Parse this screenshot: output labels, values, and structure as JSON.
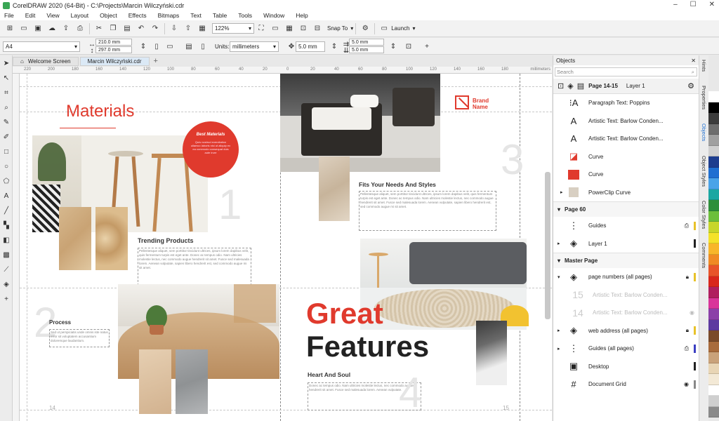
{
  "window": {
    "title": "CorelDRAW 2020 (64-Bit) - C:\\Projects\\Marcin Wilczyński.cdr",
    "min": "–",
    "max": "☐",
    "close": "✕"
  },
  "menu": [
    "File",
    "Edit",
    "View",
    "Layout",
    "Object",
    "Effects",
    "Bitmaps",
    "Text",
    "Table",
    "Tools",
    "Window",
    "Help"
  ],
  "toolbar": {
    "zoom": "122%",
    "snap_to": "Snap To",
    "launch": "Launch"
  },
  "propbar": {
    "page_size": "A4",
    "width": "210.0 mm",
    "height": "297.0 mm",
    "units_label": "Units:",
    "units": "millimeters",
    "nudge": "5.0 mm",
    "dup_x": "5.0 mm",
    "dup_y": "5.0 mm"
  },
  "tabs": [
    "Welcome Screen",
    "Marcin Wilczyński.cdr"
  ],
  "ruler": {
    "ticks": [
      "220",
      "200",
      "180",
      "160",
      "140",
      "120",
      "100",
      "80",
      "60",
      "40",
      "20",
      "0",
      "20",
      "40",
      "60",
      "80",
      "100",
      "120",
      "140",
      "160",
      "180"
    ],
    "unit": "millimeters"
  },
  "canvas": {
    "materials_title": "Materials",
    "best_materials_title": "Best Materials",
    "best_materials_text": "Quis nostrud exercitation ullamco laboris nisi ut aliquip ex ea commodo consequat duis aute irure",
    "trending_title": "Trending Products",
    "trending_text": "Pellentesque aliquet, sem porttitor tincidunt ultrices, ipsum lorem dapibus velit, quis fermentum turpis est eget ante. Donec ac tempus odio. Nam ultricies molestie lectus, nec commodo augue hendrerit sit amet. Fusce sed malesuada lorem. Aenean vulputate, sapien libero hendrerit est, sed commodo augue mi sit amet.",
    "process_title": "Process",
    "process_text": "Sed ut perspiciatis unde omnis iste natus error sit voluptatem accusantium doloremque laudantium.",
    "brand_name": "Brand\nName",
    "fits_title": "Fits Your Needs And Styles",
    "fits_text": "Pellentesque aliquet, sem porttitor tincidunt ultrices, ipsum lorem dapibus velit, quis fermentum turpis est eget ante. Donec ac tempus odio. Nam ultricies molestie lectus, nec commodo augue hendrerit sit amet. Fusce sed malesuada lorem. Aenean vulputate, sapien libero hendrerit est, sed commodo augue mi sit amet.",
    "great": "Great",
    "features": "Features",
    "heart_title": "Heart And Soul",
    "heart_text": "Donec ac tempus odio. Nam ultricies molestie lectus, nec commodo augue hendrerit sit amet. Fusce sed malesuada lorem. Aenean vulputate.",
    "page_num_big_1": "1",
    "page_num_big_2": "2",
    "page_num_big_3": "3",
    "page_num_big_4": "4",
    "page_left": "14",
    "page_right": "15"
  },
  "docker": {
    "title": "Objects",
    "search_placeholder": "Search",
    "page_label": "Page 14-15",
    "layer_label": "Layer 1",
    "items": [
      {
        "icon": "paragraph-text",
        "label": "Paragraph Text: Poppins"
      },
      {
        "icon": "artistic-text",
        "label": "Artistic Text: Barlow Conden..."
      },
      {
        "icon": "artistic-text",
        "label": "Artistic Text: Barlow Conden..."
      },
      {
        "icon": "curve",
        "label": "Curve"
      },
      {
        "icon": "curve-red",
        "label": "Curve"
      },
      {
        "icon": "powerclip",
        "label": "PowerClip Curve"
      }
    ],
    "page60": "Page 60",
    "guides": "Guides",
    "layer1": "Layer 1",
    "master_page": "Master Page",
    "page_numbers": "page numbers (all pages)",
    "ghost1": "Artistic Text: Barlow Conden...",
    "ghost2": "Artistic Text: Barlow Conden...",
    "web_address": "web address (all pages)",
    "guides_all": "Guides (all pages)",
    "desktop": "Desktop",
    "document_grid": "Document Grid"
  },
  "right_tabs": [
    "Hints",
    "Properties",
    "Objects",
    "Object Styles",
    "Color Styles",
    "Comments"
  ],
  "palette": [
    "#ffffff",
    "#000000",
    "#3c3c3c",
    "#6e6e6e",
    "#a0a0a0",
    "#d0d0d0",
    "#1d3d8f",
    "#1f6fd1",
    "#4aa3e8",
    "#1aa7a2",
    "#2d8f3a",
    "#6cbf3b",
    "#c7d62a",
    "#f4e22a",
    "#f8b62a",
    "#f08a24",
    "#e8542a",
    "#d9261c",
    "#b01e5f",
    "#d9349a",
    "#8b3fa8",
    "#5d3aa0",
    "#7a4a2a",
    "#a86b3c",
    "#c9a27a",
    "#e8d5b5",
    "#f3e9d6",
    "#ffffff",
    "#cfcfcf",
    "#8a8a8a"
  ],
  "colors": {
    "brand_red": "#e03a2d",
    "accent_blue": "#1f6fd1"
  }
}
